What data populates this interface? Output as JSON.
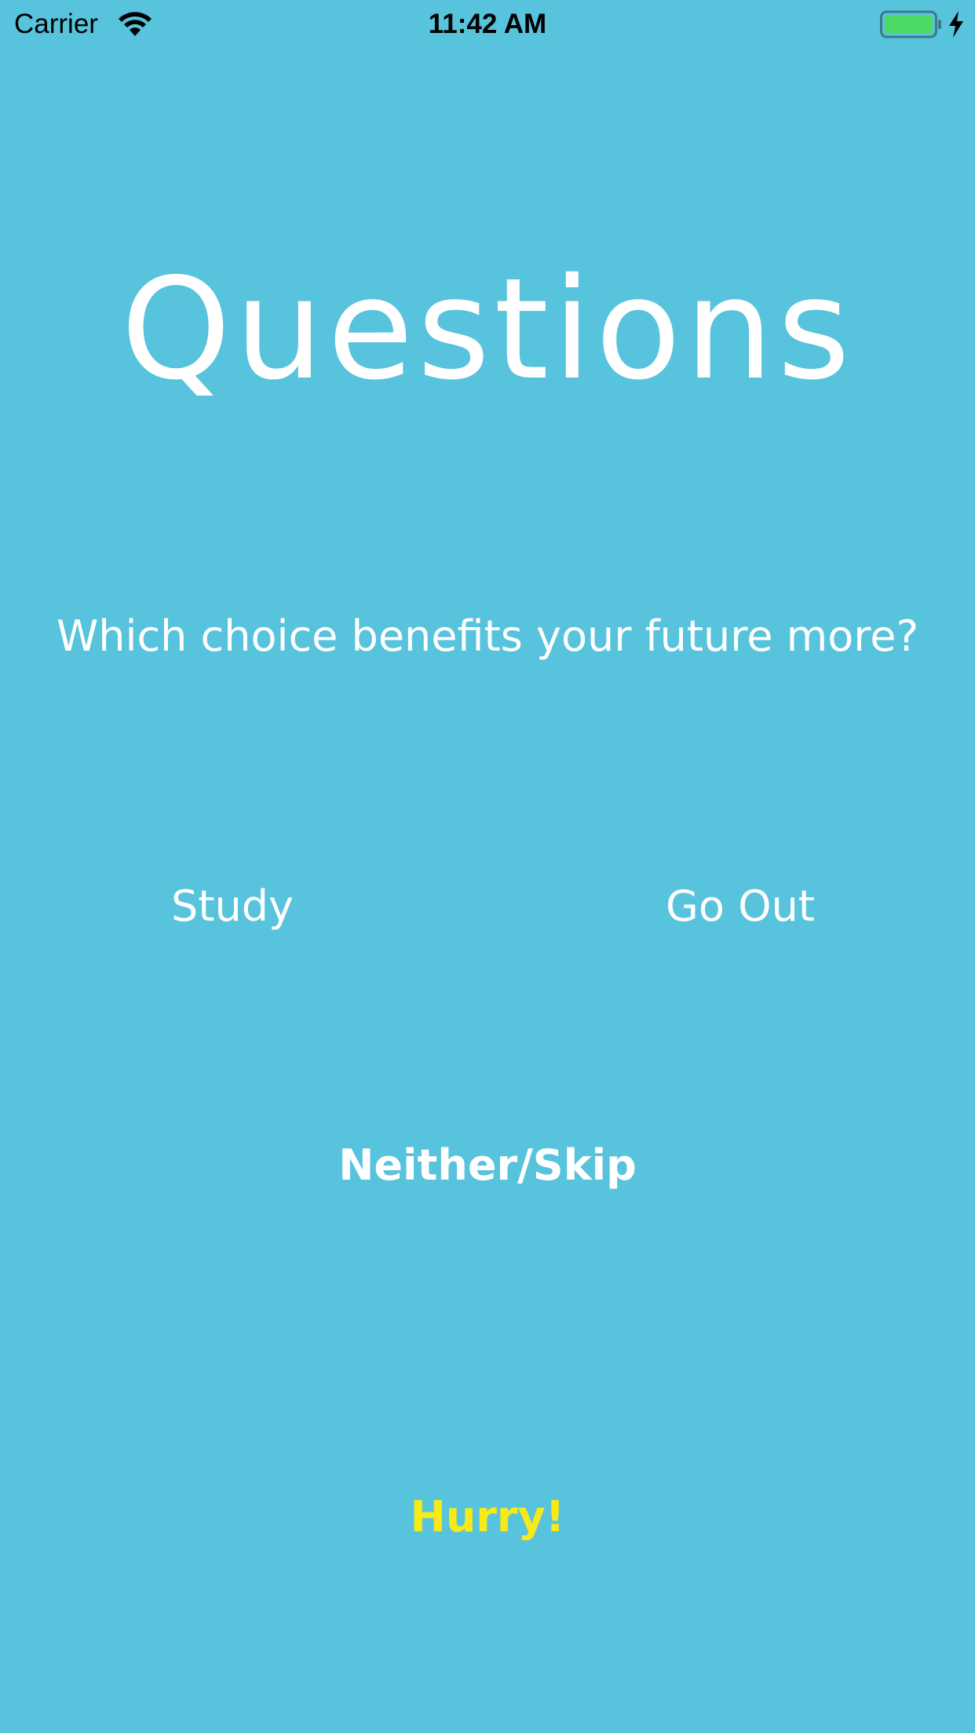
{
  "status_bar": {
    "carrier": "Carrier",
    "time": "11:42 AM",
    "icons": [
      "wifi-icon",
      "battery-icon",
      "charging-bolt-icon"
    ]
  },
  "screen": {
    "title": "Questions",
    "question": "Which choice benefits your future more?",
    "choice_left": "Study",
    "choice_right": "Go Out",
    "skip": "Neither/Skip",
    "hint": "Hurry!"
  },
  "colors": {
    "background": "#58c3dc",
    "text": "#ffffff",
    "hint": "#f7ea17",
    "battery_fill": "#4cd964"
  }
}
